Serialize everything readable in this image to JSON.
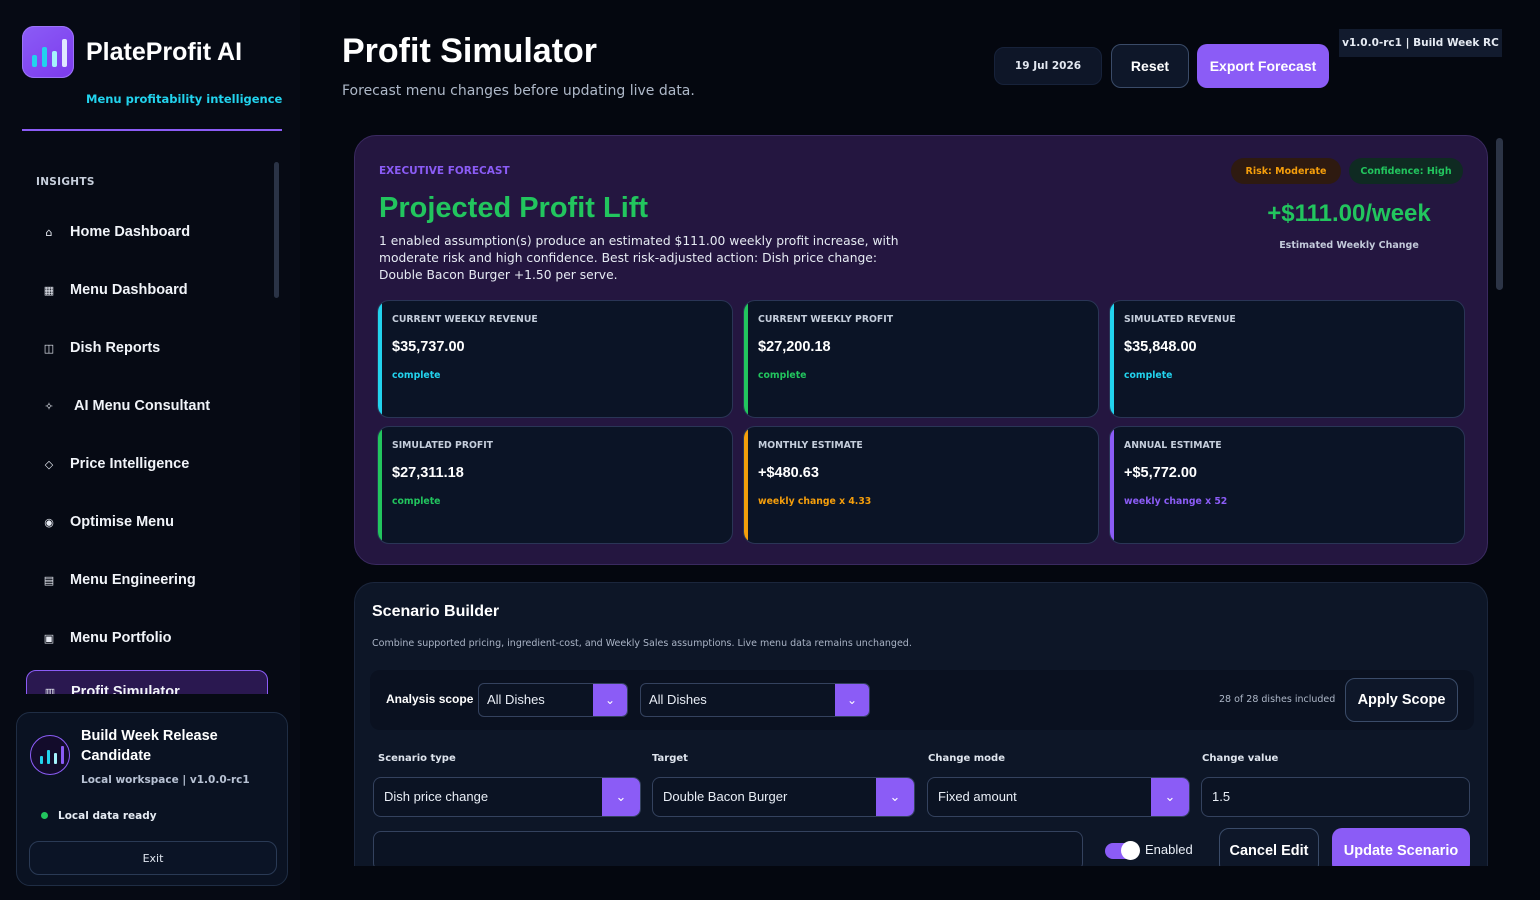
{
  "brand": {
    "name": "PlateProfit AI",
    "tagline": "Menu profitability intelligence",
    "icon": "bar-chart-logo-icon"
  },
  "sidebar": {
    "section_label": "INSIGHTS",
    "items": [
      {
        "label": "Home Dashboard",
        "icon": "⌂"
      },
      {
        "label": "Menu Dashboard",
        "icon": "▦"
      },
      {
        "label": "Dish Reports",
        "icon": "◫"
      },
      {
        "label": "AI Menu Consultant",
        "icon": "✧"
      },
      {
        "label": "Price Intelligence",
        "icon": "◇"
      },
      {
        "label": "Optimise Menu",
        "icon": "◉"
      },
      {
        "label": "Menu Engineering",
        "icon": "▤"
      },
      {
        "label": "Menu Portfolio",
        "icon": "▣"
      },
      {
        "label": "Profit Simulator",
        "icon": "▥"
      }
    ],
    "release": {
      "title": "Build Week Release Candidate",
      "subtitle": "Local workspace | v1.0.0-rc1",
      "status": "Local data ready",
      "exit_label": "Exit"
    }
  },
  "header": {
    "title": "Profit Simulator",
    "subtitle": "Forecast menu changes before updating live data.",
    "date": "19 Jul 2026",
    "reset_label": "Reset",
    "export_label": "Export Forecast",
    "version": "v1.0.0-rc1 | Build Week RC"
  },
  "forecast": {
    "kicker": "EXECUTIVE FORECAST",
    "risk": "Risk: Moderate",
    "confidence": "Confidence: High",
    "headline": "Projected Profit Lift",
    "description": "1 enabled assumption(s) produce an estimated $111.00 weekly profit increase, with moderate risk and high confidence. Best risk-adjusted action: Dish price change: Double Bacon Burger +1.50 per serve.",
    "change": "+$111.00/week",
    "change_label": "Estimated Weekly Change",
    "metrics": [
      {
        "label": "CURRENT WEEKLY REVENUE",
        "value": "$35,737.00",
        "note": "complete",
        "color": "#22d3ee"
      },
      {
        "label": "CURRENT WEEKLY PROFIT",
        "value": "$27,200.18",
        "note": "complete",
        "color": "#22c55e"
      },
      {
        "label": "SIMULATED REVENUE",
        "value": "$35,848.00",
        "note": "complete",
        "color": "#22d3ee"
      },
      {
        "label": "SIMULATED PROFIT",
        "value": "$27,311.18",
        "note": "complete",
        "color": "#22c55e"
      },
      {
        "label": "MONTHLY ESTIMATE",
        "value": "+$480.63",
        "note": "weekly change x 4.33",
        "color": "#f59e0b"
      },
      {
        "label": "ANNUAL ESTIMATE",
        "value": "+$5,772.00",
        "note": "weekly change x 52",
        "color": "#8b5cf6"
      }
    ]
  },
  "builder": {
    "title": "Scenario Builder",
    "subtitle": "Combine supported pricing, ingredient-cost, and Weekly Sales assumptions. Live menu data remains unchanged.",
    "scope_label": "Analysis scope",
    "scope_primary": "All Dishes",
    "scope_secondary": "All Dishes",
    "included": "28 of 28 dishes included",
    "apply_label": "Apply Scope",
    "scenario_type_label": "Scenario type",
    "scenario_type": "Dish price change",
    "target_label": "Target",
    "target": "Double Bacon Burger",
    "change_mode_label": "Change mode",
    "change_mode": "Fixed amount",
    "change_value_label": "Change value",
    "change_value": "1.5",
    "notes_value": "",
    "enabled_label": "Enabled",
    "cancel_label": "Cancel Edit",
    "update_label": "Update Scenario"
  },
  "colors": {
    "accent": "#8b5cf6",
    "positive": "#22c55e",
    "info": "#22d3ee",
    "warning": "#f59e0b"
  }
}
